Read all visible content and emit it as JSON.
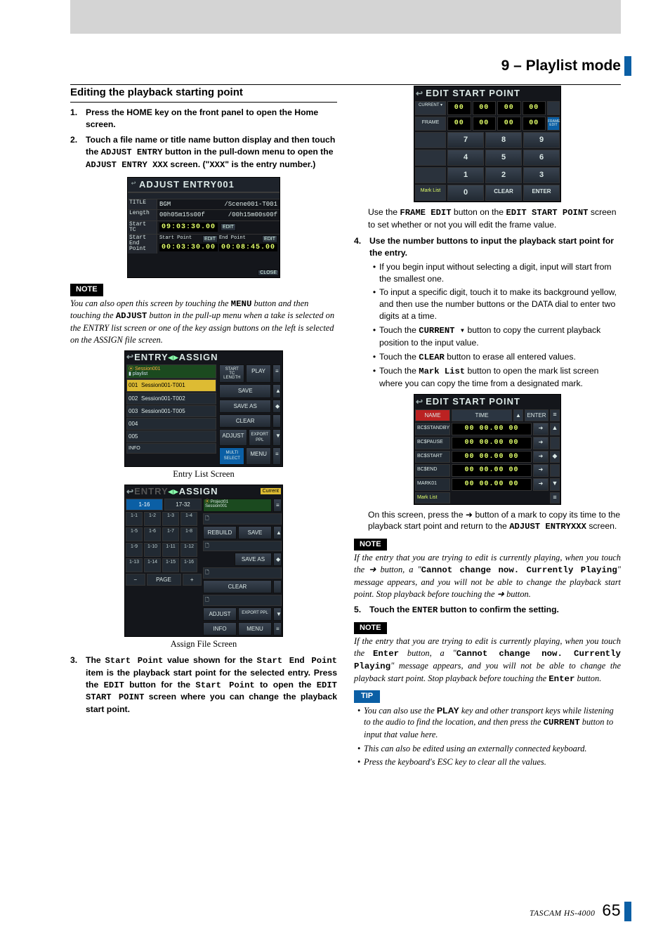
{
  "chapter": "9 – Playlist mode",
  "section_title": "Editing the playback starting point",
  "page_footer_model": "TASCAM  HS-4000",
  "page_number": "65",
  "step1": "Press the HOME key on the front panel to open the Home screen.",
  "step2_a": "Touch a file name or title name button display and then touch the ",
  "step2_b": " button in the pull-down menu to open the ",
  "step2_c": " screen. (\"",
  "step2_d": "\" is the entry number.)",
  "step2_btn1": "ADJUST ENTRY",
  "step2_btn2": "ADJUST ENTRY XXX",
  "step2_xxx": "XXX",
  "adj": {
    "title": "ADJUST ENTRY001",
    "titlex": "/Scene001-T001",
    "bgm": "BGM",
    "len_l": "Length",
    "len_v": "00h05m15s00f",
    "len_r": "/00h15m00s00f",
    "stc_l": "Start TC",
    "stc_v": "09:03:30.00",
    "edit": "EDIT",
    "sep_l": "Start End Point",
    "sp_l": "Start Point",
    "ep_l": "End Point",
    "sp_v": "00:03:30.00",
    "ep_v": "00:08:45.00",
    "close": "CLOSE"
  },
  "note_label": "NOTE",
  "tip_label": "TIP",
  "note1_a": "You can also open this screen by touching the ",
  "note1_menu": "MENU",
  "note1_b": " button and then touching the ",
  "note1_adj": "ADJUST",
  "note1_c": " button in the pull-up menu when a take is selected on the ENTRY list screen or one of the key assign buttons on the left is selected on the ASSIGN file screen.",
  "entrylist": {
    "title": "ENTRY",
    "arrow": "◂▸",
    "assign": "ASSIGN",
    "session_line1": "Session001",
    "session_line2": "playlist",
    "starttc": "START TC",
    "length": "LENGTH",
    "play": "PLAY",
    "items": [
      {
        "n": "001",
        "t": "Session001-T001"
      },
      {
        "n": "002",
        "t": "Session001-T002"
      },
      {
        "n": "003",
        "t": "Session001-T005"
      },
      {
        "n": "004",
        "t": ""
      },
      {
        "n": "005",
        "t": ""
      }
    ],
    "info": "INFO",
    "save": "SAVE",
    "saveas": "SAVE AS",
    "clear": "CLEAR",
    "adjust": "ADJUST",
    "export": "EXPORT PPL",
    "multi": "MULTI SELECT",
    "menu": "MENU"
  },
  "entrylist_caption": "Entry List Screen",
  "assignfile": {
    "title": "ENTRY",
    "arrow": "◂▸",
    "assign": "ASSIGN",
    "current": "Current",
    "proj_line1": "Project01",
    "proj_line2": "Session001",
    "tab1": "1-16",
    "tab2": "17-32",
    "slots": [
      "1-1",
      "1-2",
      "1-3",
      "1-4",
      "1-5",
      "1-6",
      "1-7",
      "1-8",
      "1-9",
      "1-10",
      "1-11",
      "1-12",
      "1-13",
      "1-14",
      "1-15",
      "1-16"
    ],
    "minus": "−",
    "page": "PAGE",
    "plus": "+",
    "rebuild": "REBUILD",
    "save": "SAVE",
    "saveas": "SAVE AS",
    "clear": "CLEAR",
    "adjust": "ADJUST",
    "export": "EXPORT PPL",
    "info": "INFO",
    "menu": "MENU"
  },
  "assignfile_caption": "Assign File Screen",
  "step3_a": "The ",
  "step3_sp": "Start Point",
  "step3_b": " value shown for the ",
  "step3_sep": "Start End Point",
  "step3_c": " item is the playback start point for the selected entry. Press the ",
  "step3_edit": "EDIT",
  "step3_d": " button for the ",
  "step3_sp2": "Start Point",
  "step3_e": " to open the ",
  "step3_esp": "EDIT START POINT",
  "step3_f": " screen where you can change the playback start point.",
  "numpad": {
    "title": "EDIT START POINT",
    "current": "CURRENT ▾",
    "frame": "FRAME EDIT",
    "d": [
      "00",
      "00",
      "00",
      "00"
    ],
    "f": [
      "00",
      "00",
      "00",
      "00"
    ],
    "n": [
      "7",
      "8",
      "9",
      "4",
      "5",
      "6",
      "1",
      "2",
      "3",
      "0",
      "CLEAR",
      "ENTER"
    ],
    "marklist": "Mark List"
  },
  "right_p1_a": "Use the ",
  "right_p1_frame": "FRAME EDIT",
  "right_p1_b": " button on the ",
  "right_p1_esp": "EDIT START POINT",
  "right_p1_c": " screen to set whether or not you will edit the frame value.",
  "step4": "Use the number buttons to input the playback start point for the entry.",
  "step4_b1": "If you begin input without selecting a digit, input will start from the smallest one.",
  "step4_b2": "To input a specific digit, touch it to make its background yellow, and then use the number buttons or the DATA dial to enter two digits at a time.",
  "step4_b3_a": "Touch the ",
  "step4_b3_btn": "CURRENT ▾",
  "step4_b3_b": " button to copy the current playback position to the input value.",
  "step4_b4_a": "Touch the ",
  "step4_b4_btn": "CLEAR",
  "step4_b4_b": " button to erase all entered values.",
  "step4_b5_a": "Touch the ",
  "step4_b5_btn": "Mark List",
  "step4_b5_b": " button to open the mark list screen where you can copy the time from a designated mark.",
  "marklist": {
    "title": "EDIT START POINT",
    "h_name": "NAME",
    "h_time": "TIME",
    "h_enter": "ENTER",
    "rows": [
      {
        "name": "BC$STANDBY",
        "t": "00 00.00 00"
      },
      {
        "name": "BC$PAUSE",
        "t": "00 00.00 00"
      },
      {
        "name": "BC$START",
        "t": "00 00.00 00"
      },
      {
        "name": "BC$END",
        "t": "00 00.00 00"
      },
      {
        "name": "MARK01",
        "t": "00 00.00 00"
      }
    ],
    "marklist": "Mark List"
  },
  "right_p2_a": "On this screen, press the ➜ button of a mark to copy its time to the playback start point and return to the ",
  "right_p2_scr": "ADJUST ENTRYXXX",
  "right_p2_b": " screen.",
  "note2_a": "If the entry that you are trying to edit is currently playing, when you touch the ➜ button, a \"",
  "note2_msg": "Cannot change now. Currently Playing",
  "note2_b": "\" message appears, and you will not be able to change the playback start point. Stop playback before touching the ➜ button.",
  "step5_a": "Touch the ",
  "step5_enter": "ENTER",
  "step5_b": " button to confirm the setting.",
  "note3_a": "If the entry that you are trying to edit is currently playing, when you touch the ",
  "note3_enter": "Enter",
  "note3_b": " button, a \"",
  "note3_msg": "Cannot change now. Currently Playing",
  "note3_c": "\" message appears, and you will not be able to change the playback start point. Stop playback before touching the ",
  "note3_enter2": "Enter",
  "note3_d": " button.",
  "tip1_a": "You can also use the ",
  "tip1_play": "PLAY",
  "tip1_b": " key and other transport keys while listening to the audio to find the location, and then press the ",
  "tip1_cur": "CURRENT",
  "tip1_c": " button to input that value here.",
  "tip2": "This can also be edited using an externally connected keyboard.",
  "tip3": "Press the keyboard's ESC key to clear all the values."
}
